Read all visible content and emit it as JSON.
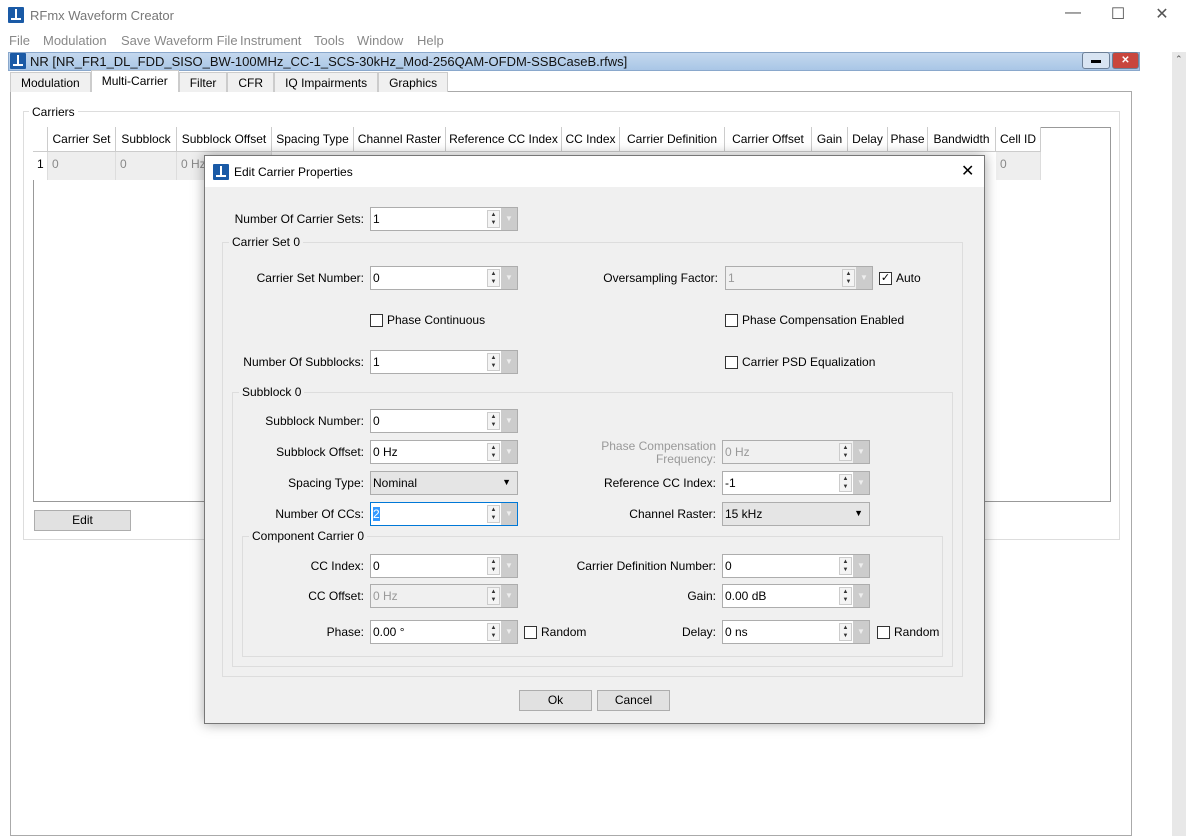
{
  "app": {
    "title": "RFmx Waveform Creator",
    "menu": [
      "File",
      "Modulation",
      "Save Waveform File",
      "Instrument",
      "Tools",
      "Window",
      "Help"
    ]
  },
  "document": {
    "title": "NR [NR_FR1_DL_FDD_SISO_BW-100MHz_CC-1_SCS-30kHz_Mod-256QAM-OFDM-SSBCaseB.rfws]"
  },
  "tabs": [
    "Modulation",
    "Multi-Carrier",
    "Filter",
    "CFR",
    "IQ Impairments",
    "Graphics"
  ],
  "selected_tab": "Multi-Carrier",
  "carriers": {
    "group_label": "Carriers",
    "columns": [
      "Carrier Set",
      "Subblock",
      "Subblock Offset",
      "Spacing Type",
      "Channel Raster",
      "Reference CC Index",
      "CC Index",
      "Carrier Definition",
      "Carrier Offset",
      "Gain",
      "Delay",
      "Phase",
      "Bandwidth",
      "Cell ID"
    ],
    "rows": [
      {
        "index": "1",
        "carrier_set": "0",
        "subblock": "0",
        "subblock_offset": "0 Hz",
        "cell_id": "0"
      }
    ],
    "edit_label": "Edit"
  },
  "dialog": {
    "title": "Edit Carrier Properties",
    "number_of_carrier_sets": {
      "label": "Number Of Carrier Sets:",
      "value": "1"
    },
    "carrier_set_group": "Carrier Set 0",
    "carrier_set_number": {
      "label": "Carrier Set Number:",
      "value": "0"
    },
    "oversampling_factor": {
      "label": "Oversampling Factor:",
      "value": "1"
    },
    "auto": {
      "label": "Auto",
      "checked": true
    },
    "phase_continuous": {
      "label": "Phase Continuous",
      "checked": false
    },
    "phase_compensation_enabled": {
      "label": "Phase Compensation Enabled",
      "checked": false
    },
    "number_of_subblocks": {
      "label": "Number Of Subblocks:",
      "value": "1"
    },
    "carrier_psd_equalization": {
      "label": "Carrier PSD Equalization",
      "checked": false
    },
    "subblock_group": "Subblock 0",
    "subblock_number": {
      "label": "Subblock Number:",
      "value": "0"
    },
    "subblock_offset": {
      "label": "Subblock Offset:",
      "value": "0 Hz"
    },
    "phase_compensation_frequency": {
      "label_line1": "Phase Compensation",
      "label_line2": "Frequency:",
      "value": "0 Hz"
    },
    "spacing_type": {
      "label": "Spacing Type:",
      "value": "Nominal"
    },
    "reference_cc_index": {
      "label": "Reference CC Index:",
      "value": "-1"
    },
    "number_of_ccs": {
      "label": "Number Of CCs:",
      "value": "2"
    },
    "channel_raster": {
      "label": "Channel Raster:",
      "value": "15 kHz"
    },
    "component_carrier_group": "Component Carrier 0",
    "cc_index": {
      "label": "CC Index:",
      "value": "0"
    },
    "carrier_definition_number": {
      "label": "Carrier Definition Number:",
      "value": "0"
    },
    "cc_offset": {
      "label": "CC Offset:",
      "value": "0 Hz"
    },
    "gain": {
      "label": "Gain:",
      "value": "0.00 dB"
    },
    "phase": {
      "label": "Phase:",
      "value": "0.00 °"
    },
    "phase_random": {
      "label": "Random",
      "checked": false
    },
    "delay": {
      "label": "Delay:",
      "value": "0 ns"
    },
    "delay_random": {
      "label": "Random",
      "checked": false
    },
    "ok_label": "Ok",
    "cancel_label": "Cancel"
  }
}
